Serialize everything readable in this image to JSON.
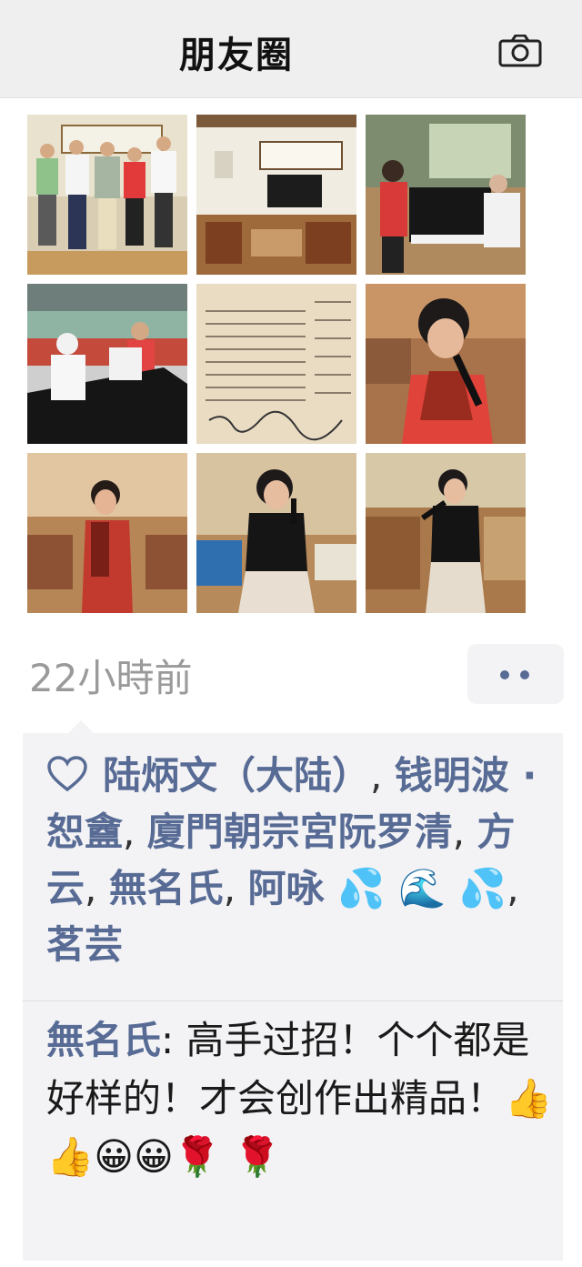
{
  "header": {
    "title": "朋友圈"
  },
  "photos": [
    {
      "label": "group-photo"
    },
    {
      "label": "meeting-room"
    },
    {
      "label": "piano-duet"
    },
    {
      "label": "piano-in-hall"
    },
    {
      "label": "music-score"
    },
    {
      "label": "singer-red-scarf"
    },
    {
      "label": "singer-red-scarf-2"
    },
    {
      "label": "singer-black-dress"
    },
    {
      "label": "singer-black-dress-2"
    }
  ],
  "post": {
    "time": "22小時前"
  },
  "likes": {
    "names": [
      "陆炳文（大陆）",
      "钱明波 · 恕盦",
      "廈門朝宗宮阮罗清",
      "方云",
      "無名氏",
      "阿咏 💦 🌊 💦",
      "茗芸"
    ],
    "separator": ", "
  },
  "comment": {
    "author": "無名氏",
    "separator": ": ",
    "text": "高手过招！个个都是好样的！才会创作出精品！👍👍😀😀🌹 🌹"
  },
  "colors": {
    "link": "#576b95",
    "header_bg": "#efefef",
    "panel_bg": "#f3f3f5",
    "time": "#9a9a9a"
  },
  "icons": [
    "camera-icon",
    "heart-icon",
    "more-icon"
  ]
}
